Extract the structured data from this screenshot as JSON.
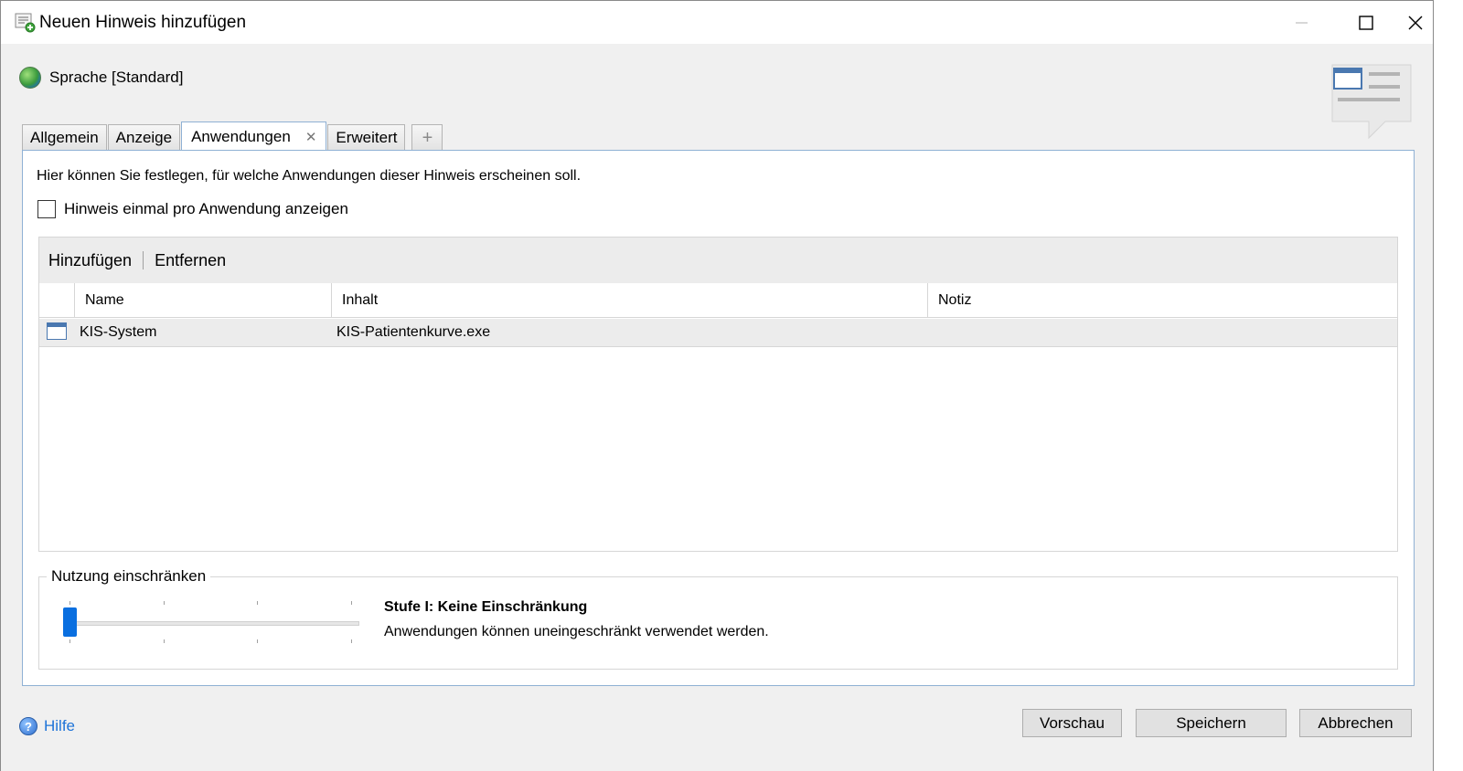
{
  "window": {
    "title": "Neuen Hinweis hinzufügen",
    "minimize_glyph": "—",
    "maximize_glyph": "☐",
    "close_glyph": "✕"
  },
  "language": {
    "label": "Sprache [Standard]",
    "icon": "globe-icon"
  },
  "tabs": [
    {
      "label": "Allgemein",
      "active": false
    },
    {
      "label": "Anzeige",
      "active": false
    },
    {
      "label": "Anwendungen",
      "active": true,
      "close_glyph": "✕"
    },
    {
      "label": "Erweitert",
      "active": false
    }
  ],
  "add_tab_glyph": "+",
  "panel": {
    "description": "Hier können Sie festlegen, für welche Anwendungen dieser Hinweis erscheinen soll.",
    "checkbox_label": "Hinweis einmal pro Anwendung anzeigen",
    "checkbox_checked": false
  },
  "list": {
    "toolbar": {
      "add_label": "Hinzufügen",
      "remove_label": "Entfernen"
    },
    "columns": [
      "Name",
      "Inhalt",
      "Notiz"
    ],
    "rows": [
      {
        "icon": "application-window-icon",
        "name": "KIS-System",
        "inhalt": "KIS-Patientenkurve.exe",
        "notiz": ""
      }
    ]
  },
  "restriction": {
    "legend": "Nutzung einschränken",
    "slider_level": 1,
    "slider_levels": 4,
    "level_title": "Stufe I: Keine Einschränkung",
    "level_description": "Anwendungen können uneingeschränkt verwendet werden."
  },
  "footer": {
    "help_label": "Hilfe",
    "preview_label": "Vorschau",
    "save_label": "Speichern",
    "cancel_label": "Abbrechen"
  },
  "colors": {
    "accent": "#0a6fe0",
    "tab_border": "#8fb1d4",
    "link": "#1e73d8"
  }
}
